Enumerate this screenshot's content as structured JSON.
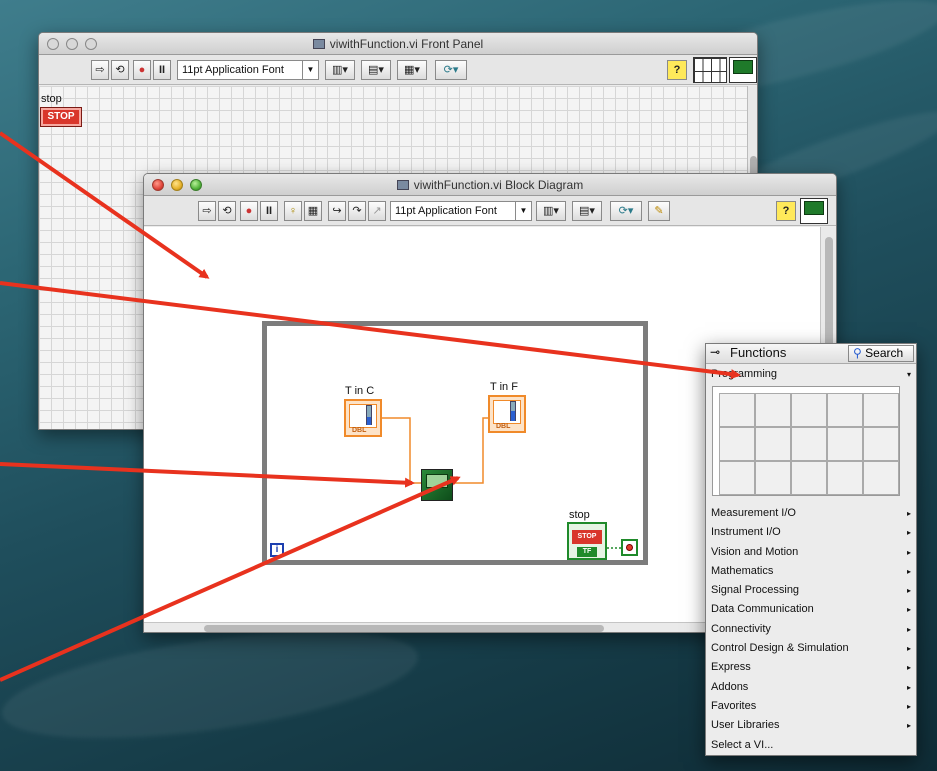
{
  "front_panel": {
    "title": "viwithFunction.vi Front Panel",
    "font_select": "11pt Application Font",
    "stop_label": "stop",
    "stop_button": "STOP",
    "help_icon": "?"
  },
  "block_diagram": {
    "title": "viwithFunction.vi Block Diagram",
    "font_select": "11pt Application Font",
    "help_icon": "?",
    "input_label": "T in C",
    "output_label": "T in F",
    "stop_label": "stop",
    "stop_terminal": "STOP",
    "stop_tf": "TF",
    "dbl": "DBL",
    "loop_index": "i"
  },
  "functions_palette": {
    "title": "Functions",
    "search_label": "Search",
    "section": "Programming",
    "items": [
      "Measurement I/O",
      "Instrument I/O",
      "Vision and Motion",
      "Mathematics",
      "Signal Processing",
      "Data Communication",
      "Connectivity",
      "Control Design & Simulation",
      "Express",
      "Addons",
      "Favorites",
      "User Libraries",
      "Select a VI..."
    ]
  },
  "colors": {
    "arrow": "#e8321e",
    "wire": "#f08a2a",
    "while_loop": "#7c7c7c",
    "stop_red": "#d9362b"
  }
}
